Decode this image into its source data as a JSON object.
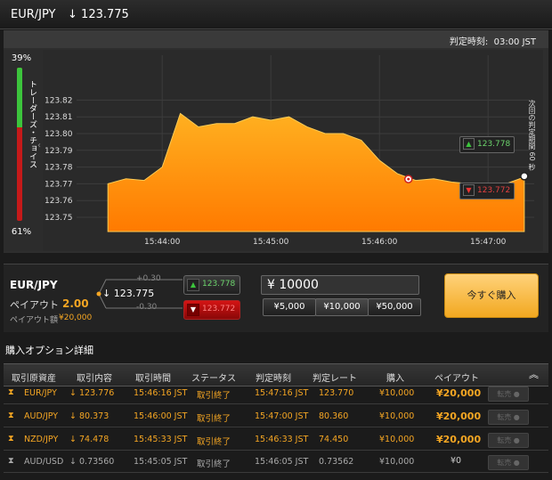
{
  "header": {
    "pair": "EUR/JPY",
    "arrow": "↓",
    "rate": "123.775"
  },
  "deadline": {
    "label": "判定時刻:",
    "time": "03:00 JST"
  },
  "trader_choice": {
    "label": "トレーダーズ・チョイス",
    "up_pct": "39%",
    "down_pct": "61%",
    "up_fraction": 0.39
  },
  "chart": {
    "y_ticks": [
      "123.82",
      "123.81",
      "123.80",
      "123.79",
      "123.78",
      "123.77",
      "123.76",
      "123.75"
    ],
    "x_ticks": [
      "15:44:00",
      "15:45:00",
      "15:46:00",
      "15:47:00",
      "15:48:00"
    ],
    "countdown_label": "次回の判定期間 60 秒",
    "buy_up": "123.778",
    "buy_down": "123.772",
    "fill_top": "#ffb020",
    "fill_bottom": "#ff7a00"
  },
  "chart_data": {
    "type": "area",
    "x": [
      "15:43:30",
      "15:43:40",
      "15:43:50",
      "15:44:00",
      "15:44:10",
      "15:44:20",
      "15:44:30",
      "15:44:40",
      "15:44:50",
      "15:45:00",
      "15:45:10",
      "15:45:20",
      "15:45:30",
      "15:45:40",
      "15:45:50",
      "15:46:00",
      "15:46:10",
      "15:46:20",
      "15:46:30",
      "15:46:40",
      "15:46:50",
      "15:47:00",
      "15:47:10",
      "15:47:20"
    ],
    "y": [
      123.77,
      123.773,
      123.772,
      123.78,
      123.812,
      123.804,
      123.806,
      123.806,
      123.81,
      123.808,
      123.81,
      123.804,
      123.8,
      123.8,
      123.796,
      123.784,
      123.776,
      123.772,
      123.773,
      123.771,
      123.77,
      123.766,
      123.77,
      123.774
    ],
    "ylim": [
      123.74,
      123.83
    ]
  },
  "order": {
    "pair": "EUR/JPY",
    "rate_arrow": "↓",
    "rate": "123.775",
    "offset_up": "+0.30",
    "offset_down": "-0.30",
    "payout_label": "ペイアウト",
    "payout_value": "2.00",
    "payout_amount_label": "ペイアウト額",
    "payout_amount": "¥20,000",
    "buy_up": "123.778",
    "buy_down": "123.772",
    "amount_value": "¥ 10000",
    "chips": [
      "¥5,000",
      "¥10,000",
      "¥50,000"
    ],
    "buy_now": "今すぐ購入"
  },
  "details": {
    "title": "購入オプション詳細",
    "headers": [
      "取引原資産",
      "取引内容",
      "取引時間",
      "ステータス",
      "判定時刻",
      "判定レート",
      "購入",
      "ペイアウト"
    ],
    "rows": [
      {
        "asset": "EUR/JPY",
        "arrow": "↓",
        "rate": "123.776",
        "time": "15:46:16 JST",
        "status": "取引終了",
        "judge": "15:47:16 JST",
        "judge_rate": "123.770",
        "buy": "¥10,000",
        "payout": "¥20,000",
        "btn": "転売",
        "active": true
      },
      {
        "asset": "AUD/JPY",
        "arrow": "↓",
        "rate": "80.373",
        "time": "15:46:00 JST",
        "status": "取引終了",
        "judge": "15:47:00 JST",
        "judge_rate": "80.360",
        "buy": "¥10,000",
        "payout": "¥20,000",
        "btn": "転売",
        "active": true
      },
      {
        "asset": "NZD/JPY",
        "arrow": "↓",
        "rate": "74.478",
        "time": "15:45:33 JST",
        "status": "取引終了",
        "judge": "15:46:33 JST",
        "judge_rate": "74.450",
        "buy": "¥10,000",
        "payout": "¥20,000",
        "btn": "転売",
        "active": true
      },
      {
        "asset": "AUD/USD",
        "arrow": "↓",
        "rate": "0.73560",
        "time": "15:45:05 JST",
        "status": "取引終了",
        "judge": "15:46:05 JST",
        "judge_rate": "0.73562",
        "buy": "¥10,000",
        "payout": "¥0",
        "btn": "転売",
        "active": false
      }
    ]
  }
}
